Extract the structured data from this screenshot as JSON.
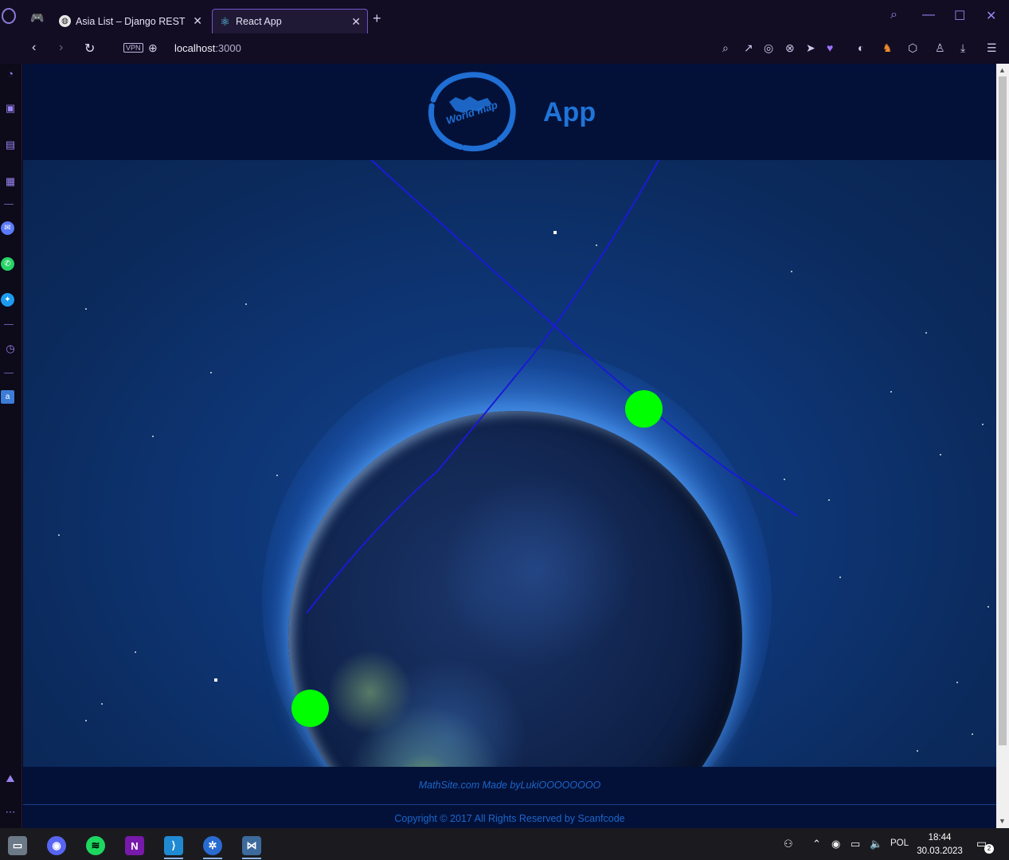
{
  "browser": {
    "tabs": [
      {
        "label": "Asia List – Django REST framework",
        "favicon": "globe-icon",
        "active": false
      },
      {
        "label": "React App",
        "favicon": "react-icon",
        "active": true
      }
    ],
    "new_tab_icon": "plus-icon",
    "address": {
      "host": "localhost",
      "port": ":3000"
    },
    "vpn_label": "VPN"
  },
  "page": {
    "header": {
      "logo_text": "World map",
      "app_title": "App"
    },
    "footer": {
      "made_by": "MathSite.com Made byLukiOOOOOOOO",
      "copyright": "Copyright © 2017 All Rights Reserved by Scanfcode"
    },
    "colors": {
      "marker": "#00ff00",
      "route": "#1a1ad6",
      "title": "#1f74d8"
    }
  },
  "taskbar": {
    "language": "POL",
    "time": "18:44",
    "date": "30.03.2023",
    "notification_count": "2",
    "discord_badge": "9+"
  }
}
